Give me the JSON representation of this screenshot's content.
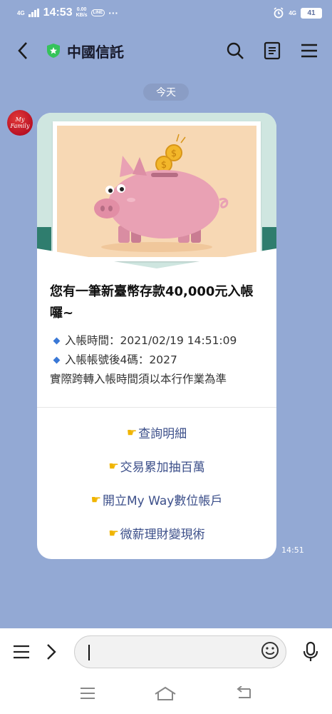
{
  "status_bar": {
    "signal": "4G",
    "time": "14:53",
    "net_speed_value": "0.00",
    "net_speed_unit": "KB/s",
    "line_badge": "LINE",
    "dots": "···",
    "network_right": "4G",
    "battery": "41"
  },
  "header": {
    "title": "中國信託"
  },
  "chat": {
    "date_label": "今天",
    "avatar_text": "My Family",
    "message": {
      "title": "您有一筆新臺幣存款40,000元入帳囉~",
      "info": [
        "入帳時間：2021/02/19 14:51:09",
        "入帳帳號後4碼：2027"
      ],
      "note": "實際跨轉入帳時間須以本行作業為準",
      "actions": [
        "查詢明細",
        "交易累加抽百萬",
        "開立My Way數位帳戶",
        "微薪理財變現術"
      ],
      "time": "14:51"
    }
  },
  "input": {
    "value": ""
  },
  "colors": {
    "background": "#93a9d4",
    "card": "#ffffff",
    "action_text": "#3c4f8a",
    "accent_green": "#35c35a",
    "pig": "#e9a1b4",
    "coin": "#f3b72a"
  }
}
